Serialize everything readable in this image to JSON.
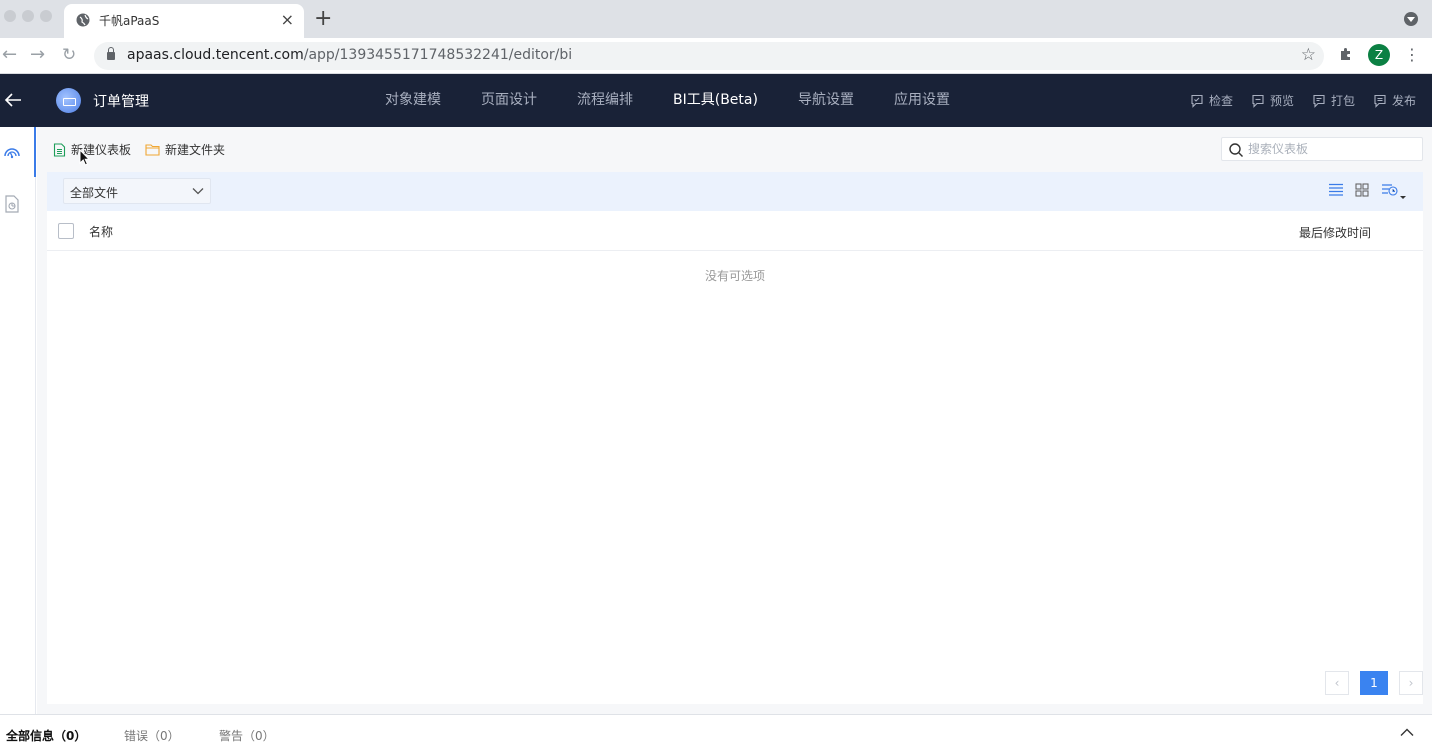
{
  "browser": {
    "tab_title": "千帆aPaaS",
    "url_host": "apaas.cloud.tencent.com",
    "url_path": "/app/1393455171748532241/editor/bi",
    "profile_initial": "Z"
  },
  "header": {
    "app_name": "订单管理",
    "nav": [
      {
        "label": "对象建模"
      },
      {
        "label": "页面设计"
      },
      {
        "label": "流程编排"
      },
      {
        "label": "BI工具(Beta)"
      },
      {
        "label": "导航设置"
      },
      {
        "label": "应用设置"
      }
    ],
    "active_nav": "BI工具(Beta)",
    "actions": [
      {
        "label": "检查",
        "icon": "check-icon"
      },
      {
        "label": "预览",
        "icon": "preview-icon"
      },
      {
        "label": "打包",
        "icon": "package-icon"
      },
      {
        "label": "发布",
        "icon": "publish-icon"
      }
    ]
  },
  "rail": {
    "items": [
      {
        "icon": "dashboard-icon",
        "active": true
      },
      {
        "icon": "report-icon",
        "active": false
      }
    ]
  },
  "main": {
    "new_dashboard": "新建仪表板",
    "new_folder": "新建文件夹",
    "search_placeholder": "搜索仪表板",
    "filter_value": "全部文件",
    "columns": {
      "name": "名称",
      "modified": "最后修改时间"
    },
    "empty_text": "没有可选项",
    "pagination": {
      "current_page": "1"
    }
  },
  "console": {
    "tabs": [
      {
        "label": "全部信息（0）",
        "active": true
      },
      {
        "label": "错误（0）",
        "active": false
      },
      {
        "label": "警告（0）",
        "active": false
      }
    ]
  },
  "colors": {
    "header_bg": "#192237",
    "accent": "#3a83f0",
    "filter_bg": "#ebf2fd"
  }
}
